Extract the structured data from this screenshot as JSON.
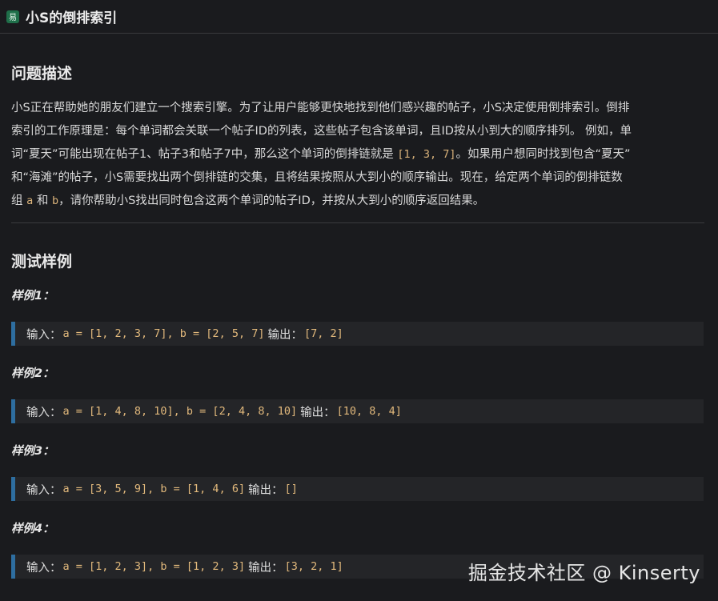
{
  "header": {
    "difficulty_badge": "易",
    "title": "小S的倒排索引"
  },
  "problem": {
    "heading": "问题描述",
    "line1_a": "小S正在帮助她的朋友们建立一个搜索引擎。为了让用户能够更快地找到他们感兴趣的帖子，小S决定使用倒排索引。倒排",
    "line2_a": "索引的工作原理是：每个单词都会关联一个帖子ID的列表，这些帖子包含该单词，且ID按从小到大的顺序排列。 例如，单",
    "line3_a": "词“夏天”可能出现在帖子1、帖子3和帖子7中，那么这个单词的倒排链就是 ",
    "line3_code": "[1, 3, 7]",
    "line3_b": "。如果用户想同时找到包含“夏天”",
    "line4_a": "和“海滩”的帖子，小S需要找出两个倒排链的交集，且将结果按照从大到小的顺序输出。现在，给定两个单词的倒排链数",
    "line5_a": "组 ",
    "line5_code_a": "a",
    "line5_b": " 和 ",
    "line5_code_b": "b",
    "line5_c": "，请你帮助小S找出同时包含这两个单词的帖子ID，并按从大到小的顺序返回结果。"
  },
  "tests": {
    "heading": "测试样例",
    "samples": [
      {
        "label": "样例1：",
        "input_prefix": "输入：",
        "input": "a = [1, 2, 3, 7], b = [2, 5, 7]",
        "output_prefix": "输出：",
        "output": "[7, 2]"
      },
      {
        "label": "样例2：",
        "input_prefix": "输入：",
        "input": "a = [1, 4, 8, 10], b = [2, 4, 8, 10]",
        "output_prefix": "输出：",
        "output": "[10, 8, 4]"
      },
      {
        "label": "样例3：",
        "input_prefix": "输入：",
        "input": "a = [3, 5, 9], b = [1, 4, 6]",
        "output_prefix": "输出：",
        "output": "[]"
      },
      {
        "label": "样例4：",
        "input_prefix": "输入：",
        "input": "a = [1, 2, 3], b = [1, 2, 3]",
        "output_prefix": "输出：",
        "output": "[3, 2, 1]"
      }
    ]
  },
  "watermark": "掘金技术社区 @ Kinserty"
}
